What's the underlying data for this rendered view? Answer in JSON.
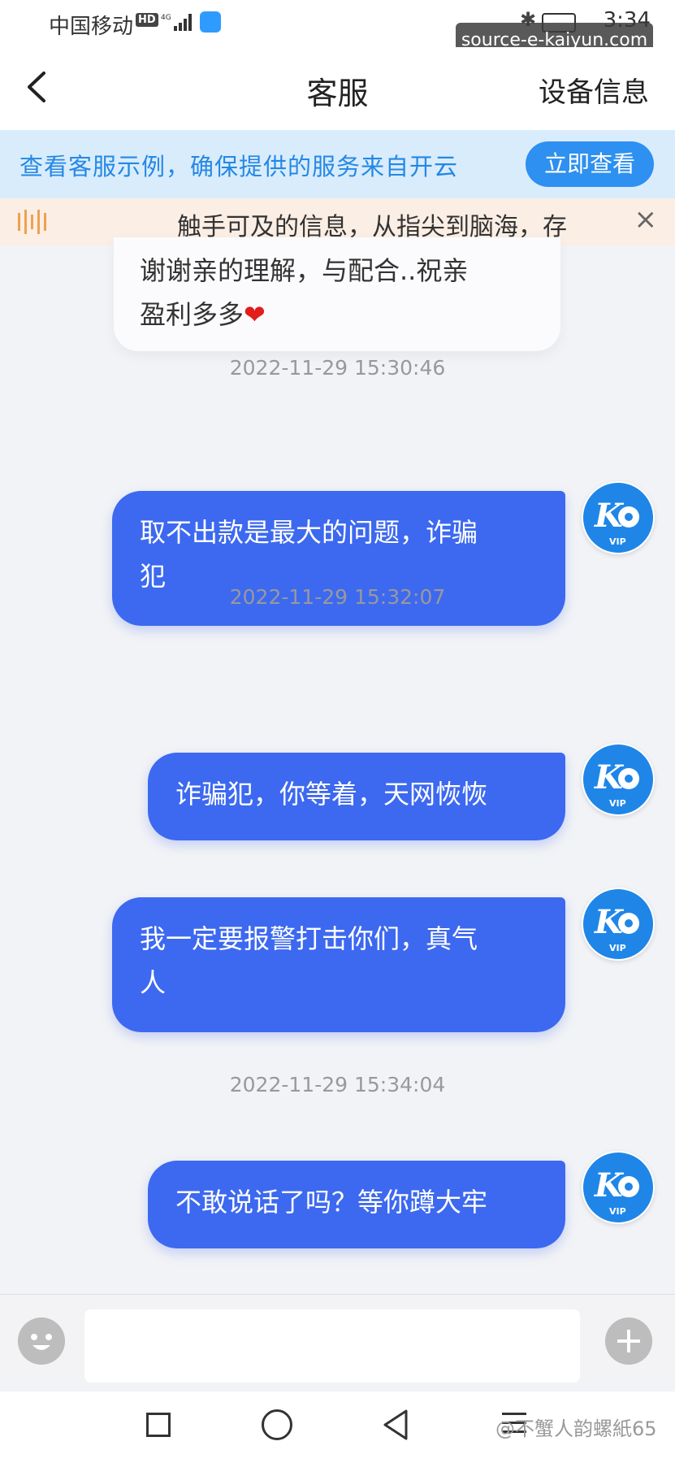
{
  "status": {
    "carrier": "中国移动",
    "hd": "HD",
    "time": "3:34",
    "watermark": "source-e-kaiyun.com"
  },
  "header": {
    "title": "客服",
    "right_label": "设备信息"
  },
  "banner": {
    "text": "查看客服示例，确保提供的服务来自开云",
    "button": "立即查看"
  },
  "notice": {
    "text": "触手可及的信息，从指尖到脑海，存"
  },
  "messages": {
    "incoming": {
      "line1": "谢谢亲的理解，与配合..祝亲",
      "line2": "盈利多多"
    },
    "ts1": "2022-11-29 15:30:46",
    "m1_line1": "取不出款是最大的问题，诈骗",
    "m1_line2": "犯",
    "ts2": "2022-11-29 15:32:07",
    "m2": "诈骗犯，你等着，天网恢恢",
    "m3_line1": "我一定要报警打击你们，真气",
    "m3_line2": "人",
    "ts3": "2022-11-29 15:34:04",
    "m4": "不敢说话了吗？等你蹲大牢",
    "avatar_label": "VIP"
  },
  "input": {
    "placeholder": ""
  },
  "footer": {
    "watermark": "@不蟹人韵螺紙65"
  },
  "colors": {
    "bubble": "#3d69f0",
    "banner_bg": "#d9ecfb",
    "banner_text": "#2488e6",
    "notice_bg": "#fbeee4"
  }
}
